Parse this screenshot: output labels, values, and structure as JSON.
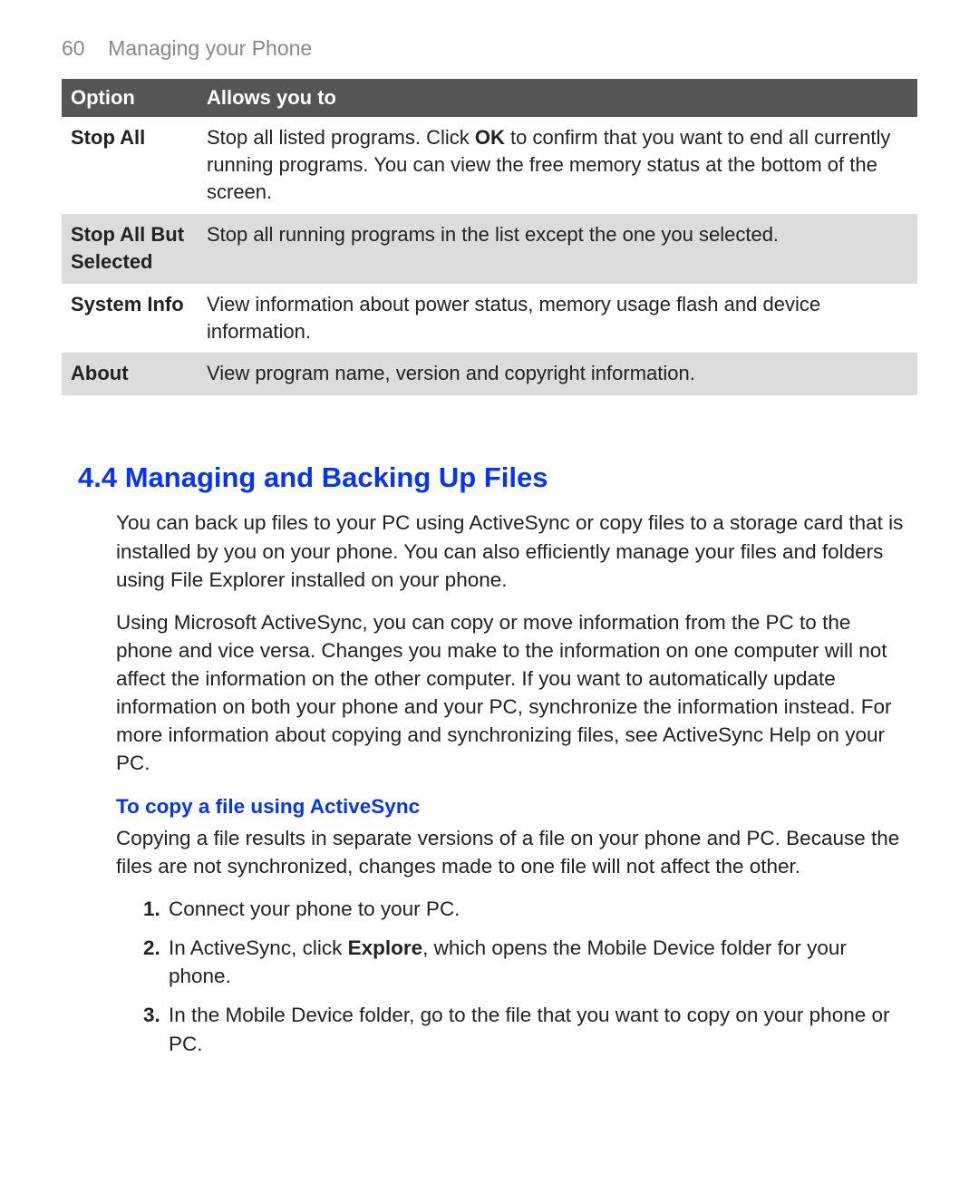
{
  "header": {
    "page_number": "60",
    "chapter_title": "Managing your Phone"
  },
  "table": {
    "headers": {
      "option": "Option",
      "allows": "Allows you to"
    },
    "rows": {
      "r0": {
        "option": "Stop All",
        "desc_pre": "Stop all listed programs. Click ",
        "desc_bold": "OK",
        "desc_post": " to confirm that you want to end all currently running programs. You can view the free memory status at the bottom of the screen."
      },
      "r1": {
        "option": "Stop All But Selected",
        "desc": "Stop all running programs in the list except the one you selected."
      },
      "r2": {
        "option": "System Info",
        "desc": "View information about power status, memory usage flash and device information."
      },
      "r3": {
        "option": "About",
        "desc": "View program name, version and copyright information."
      }
    }
  },
  "section": {
    "heading": "4.4 Managing and Backing Up Files",
    "p1": "You can back up files to your PC using ActiveSync or copy files to a storage card that is installed by you on your phone. You can also efficiently manage your files and folders using File Explorer installed on your phone.",
    "p2": "Using Microsoft ActiveSync, you can copy or move information from the PC to the phone and vice versa. Changes you make to the information on one computer will not affect the information on the other computer. If you want to automatically update information on both your phone and your PC, synchronize the information instead. For more information about copying and synchronizing files, see ActiveSync Help on your PC.",
    "subheading": "To copy a file using ActiveSync",
    "p3": "Copying a file results in separate versions of a file on your phone and PC. Because the files are not synchronized, changes made to one file will not affect the other.",
    "steps": {
      "s1": {
        "num": "1.",
        "text": "Connect your phone to your PC."
      },
      "s2": {
        "num": "2.",
        "pre": "In ActiveSync, click ",
        "bold": "Explore",
        "post": ", which opens the Mobile Device folder for your phone."
      },
      "s3": {
        "num": "3.",
        "text": "In the Mobile Device folder, go to the file that you want to copy on your phone or PC."
      }
    }
  }
}
